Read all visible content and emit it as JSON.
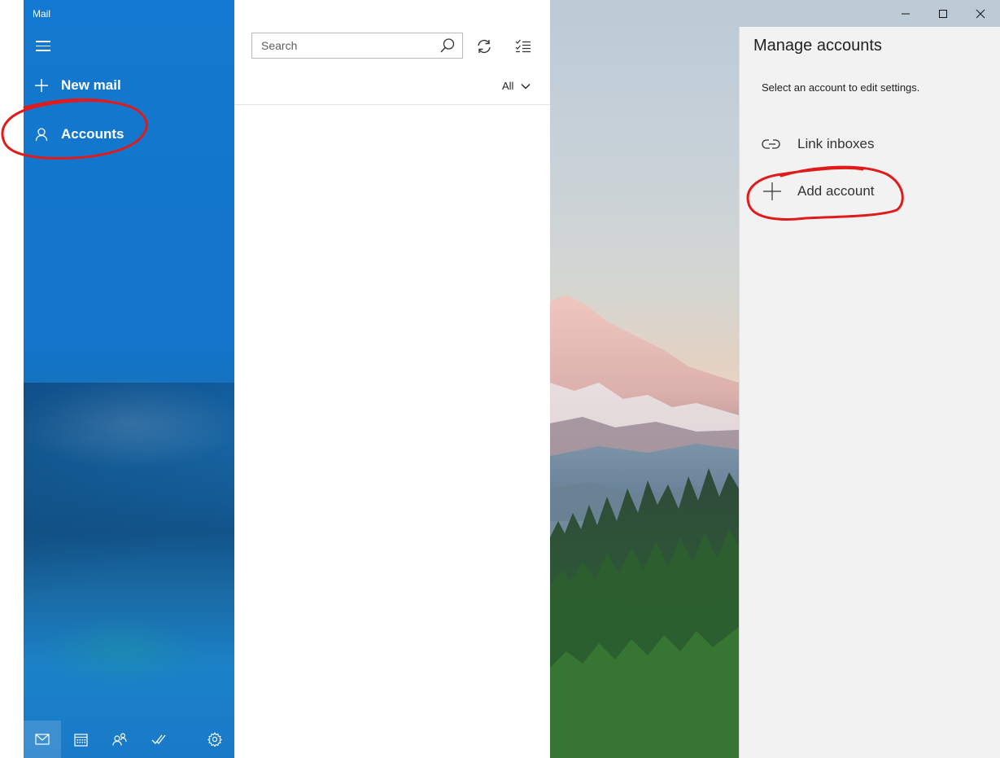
{
  "app": {
    "title": "Mail"
  },
  "sidebar": {
    "menu_icon": "hamburger-menu-icon",
    "new_mail_label": "New mail",
    "accounts_label": "Accounts",
    "bottom_icons": [
      "mail-icon",
      "calendar-icon",
      "people-icon",
      "todo-icon",
      "settings-icon"
    ],
    "active_bottom": "mail-icon",
    "background_color": "#1378cf"
  },
  "list_pane": {
    "search": {
      "placeholder": "Search",
      "value": ""
    },
    "filter": {
      "selected": "All"
    },
    "toolbar_icons": [
      "sync-icon",
      "select-mode-icon"
    ]
  },
  "window_controls": [
    "minimize-icon",
    "maximize-icon",
    "close-icon"
  ],
  "manage_accounts": {
    "title": "Manage accounts",
    "subtitle": "Select an account to edit settings.",
    "items": [
      {
        "label": "Link inboxes",
        "icon": "link-icon"
      },
      {
        "label": "Add account",
        "icon": "plus-icon"
      }
    ]
  },
  "annotations": {
    "color": "#e01b1b",
    "circled": [
      "Accounts",
      "Add account"
    ]
  }
}
